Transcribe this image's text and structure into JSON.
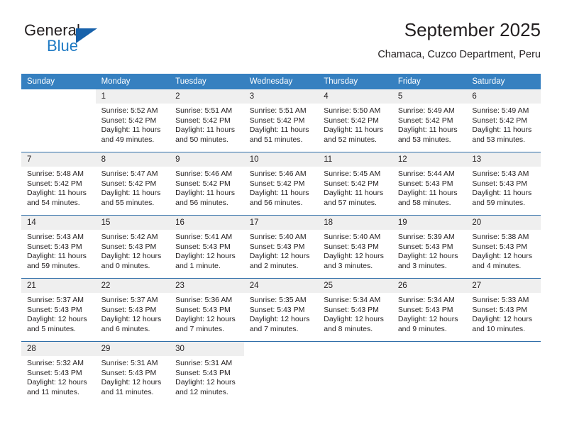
{
  "brand": {
    "name_part1": "General",
    "name_part2": "Blue",
    "triangle_icon": "triangle-logo-icon",
    "color_primary": "#1862ab",
    "color_secondary": "#1f7ac4"
  },
  "header": {
    "title": "September 2025",
    "subtitle": "Chamaca, Cuzco Department, Peru"
  },
  "theme": {
    "header_row_bg": "#3680c0",
    "daynum_band_bg": "#efefef",
    "week_separator": "#2f6ea8",
    "text": "#231f20"
  },
  "weekday_headers": [
    "Sunday",
    "Monday",
    "Tuesday",
    "Wednesday",
    "Thursday",
    "Friday",
    "Saturday"
  ],
  "weeks": [
    [
      {
        "day": "",
        "empty": true
      },
      {
        "day": "1",
        "sunrise": "Sunrise: 5:52 AM",
        "sunset": "Sunset: 5:42 PM",
        "daylight_l1": "Daylight: 11 hours",
        "daylight_l2": "and 49 minutes."
      },
      {
        "day": "2",
        "sunrise": "Sunrise: 5:51 AM",
        "sunset": "Sunset: 5:42 PM",
        "daylight_l1": "Daylight: 11 hours",
        "daylight_l2": "and 50 minutes."
      },
      {
        "day": "3",
        "sunrise": "Sunrise: 5:51 AM",
        "sunset": "Sunset: 5:42 PM",
        "daylight_l1": "Daylight: 11 hours",
        "daylight_l2": "and 51 minutes."
      },
      {
        "day": "4",
        "sunrise": "Sunrise: 5:50 AM",
        "sunset": "Sunset: 5:42 PM",
        "daylight_l1": "Daylight: 11 hours",
        "daylight_l2": "and 52 minutes."
      },
      {
        "day": "5",
        "sunrise": "Sunrise: 5:49 AM",
        "sunset": "Sunset: 5:42 PM",
        "daylight_l1": "Daylight: 11 hours",
        "daylight_l2": "and 53 minutes."
      },
      {
        "day": "6",
        "sunrise": "Sunrise: 5:49 AM",
        "sunset": "Sunset: 5:42 PM",
        "daylight_l1": "Daylight: 11 hours",
        "daylight_l2": "and 53 minutes."
      }
    ],
    [
      {
        "day": "7",
        "sunrise": "Sunrise: 5:48 AM",
        "sunset": "Sunset: 5:42 PM",
        "daylight_l1": "Daylight: 11 hours",
        "daylight_l2": "and 54 minutes."
      },
      {
        "day": "8",
        "sunrise": "Sunrise: 5:47 AM",
        "sunset": "Sunset: 5:42 PM",
        "daylight_l1": "Daylight: 11 hours",
        "daylight_l2": "and 55 minutes."
      },
      {
        "day": "9",
        "sunrise": "Sunrise: 5:46 AM",
        "sunset": "Sunset: 5:42 PM",
        "daylight_l1": "Daylight: 11 hours",
        "daylight_l2": "and 56 minutes."
      },
      {
        "day": "10",
        "sunrise": "Sunrise: 5:46 AM",
        "sunset": "Sunset: 5:42 PM",
        "daylight_l1": "Daylight: 11 hours",
        "daylight_l2": "and 56 minutes."
      },
      {
        "day": "11",
        "sunrise": "Sunrise: 5:45 AM",
        "sunset": "Sunset: 5:42 PM",
        "daylight_l1": "Daylight: 11 hours",
        "daylight_l2": "and 57 minutes."
      },
      {
        "day": "12",
        "sunrise": "Sunrise: 5:44 AM",
        "sunset": "Sunset: 5:43 PM",
        "daylight_l1": "Daylight: 11 hours",
        "daylight_l2": "and 58 minutes."
      },
      {
        "day": "13",
        "sunrise": "Sunrise: 5:43 AM",
        "sunset": "Sunset: 5:43 PM",
        "daylight_l1": "Daylight: 11 hours",
        "daylight_l2": "and 59 minutes."
      }
    ],
    [
      {
        "day": "14",
        "sunrise": "Sunrise: 5:43 AM",
        "sunset": "Sunset: 5:43 PM",
        "daylight_l1": "Daylight: 11 hours",
        "daylight_l2": "and 59 minutes."
      },
      {
        "day": "15",
        "sunrise": "Sunrise: 5:42 AM",
        "sunset": "Sunset: 5:43 PM",
        "daylight_l1": "Daylight: 12 hours",
        "daylight_l2": "and 0 minutes."
      },
      {
        "day": "16",
        "sunrise": "Sunrise: 5:41 AM",
        "sunset": "Sunset: 5:43 PM",
        "daylight_l1": "Daylight: 12 hours",
        "daylight_l2": "and 1 minute."
      },
      {
        "day": "17",
        "sunrise": "Sunrise: 5:40 AM",
        "sunset": "Sunset: 5:43 PM",
        "daylight_l1": "Daylight: 12 hours",
        "daylight_l2": "and 2 minutes."
      },
      {
        "day": "18",
        "sunrise": "Sunrise: 5:40 AM",
        "sunset": "Sunset: 5:43 PM",
        "daylight_l1": "Daylight: 12 hours",
        "daylight_l2": "and 3 minutes."
      },
      {
        "day": "19",
        "sunrise": "Sunrise: 5:39 AM",
        "sunset": "Sunset: 5:43 PM",
        "daylight_l1": "Daylight: 12 hours",
        "daylight_l2": "and 3 minutes."
      },
      {
        "day": "20",
        "sunrise": "Sunrise: 5:38 AM",
        "sunset": "Sunset: 5:43 PM",
        "daylight_l1": "Daylight: 12 hours",
        "daylight_l2": "and 4 minutes."
      }
    ],
    [
      {
        "day": "21",
        "sunrise": "Sunrise: 5:37 AM",
        "sunset": "Sunset: 5:43 PM",
        "daylight_l1": "Daylight: 12 hours",
        "daylight_l2": "and 5 minutes."
      },
      {
        "day": "22",
        "sunrise": "Sunrise: 5:37 AM",
        "sunset": "Sunset: 5:43 PM",
        "daylight_l1": "Daylight: 12 hours",
        "daylight_l2": "and 6 minutes."
      },
      {
        "day": "23",
        "sunrise": "Sunrise: 5:36 AM",
        "sunset": "Sunset: 5:43 PM",
        "daylight_l1": "Daylight: 12 hours",
        "daylight_l2": "and 7 minutes."
      },
      {
        "day": "24",
        "sunrise": "Sunrise: 5:35 AM",
        "sunset": "Sunset: 5:43 PM",
        "daylight_l1": "Daylight: 12 hours",
        "daylight_l2": "and 7 minutes."
      },
      {
        "day": "25",
        "sunrise": "Sunrise: 5:34 AM",
        "sunset": "Sunset: 5:43 PM",
        "daylight_l1": "Daylight: 12 hours",
        "daylight_l2": "and 8 minutes."
      },
      {
        "day": "26",
        "sunrise": "Sunrise: 5:34 AM",
        "sunset": "Sunset: 5:43 PM",
        "daylight_l1": "Daylight: 12 hours",
        "daylight_l2": "and 9 minutes."
      },
      {
        "day": "27",
        "sunrise": "Sunrise: 5:33 AM",
        "sunset": "Sunset: 5:43 PM",
        "daylight_l1": "Daylight: 12 hours",
        "daylight_l2": "and 10 minutes."
      }
    ],
    [
      {
        "day": "28",
        "sunrise": "Sunrise: 5:32 AM",
        "sunset": "Sunset: 5:43 PM",
        "daylight_l1": "Daylight: 12 hours",
        "daylight_l2": "and 11 minutes."
      },
      {
        "day": "29",
        "sunrise": "Sunrise: 5:31 AM",
        "sunset": "Sunset: 5:43 PM",
        "daylight_l1": "Daylight: 12 hours",
        "daylight_l2": "and 11 minutes."
      },
      {
        "day": "30",
        "sunrise": "Sunrise: 5:31 AM",
        "sunset": "Sunset: 5:43 PM",
        "daylight_l1": "Daylight: 12 hours",
        "daylight_l2": "and 12 minutes."
      },
      {
        "day": "",
        "empty": true
      },
      {
        "day": "",
        "empty": true
      },
      {
        "day": "",
        "empty": true
      },
      {
        "day": "",
        "empty": true
      }
    ]
  ]
}
